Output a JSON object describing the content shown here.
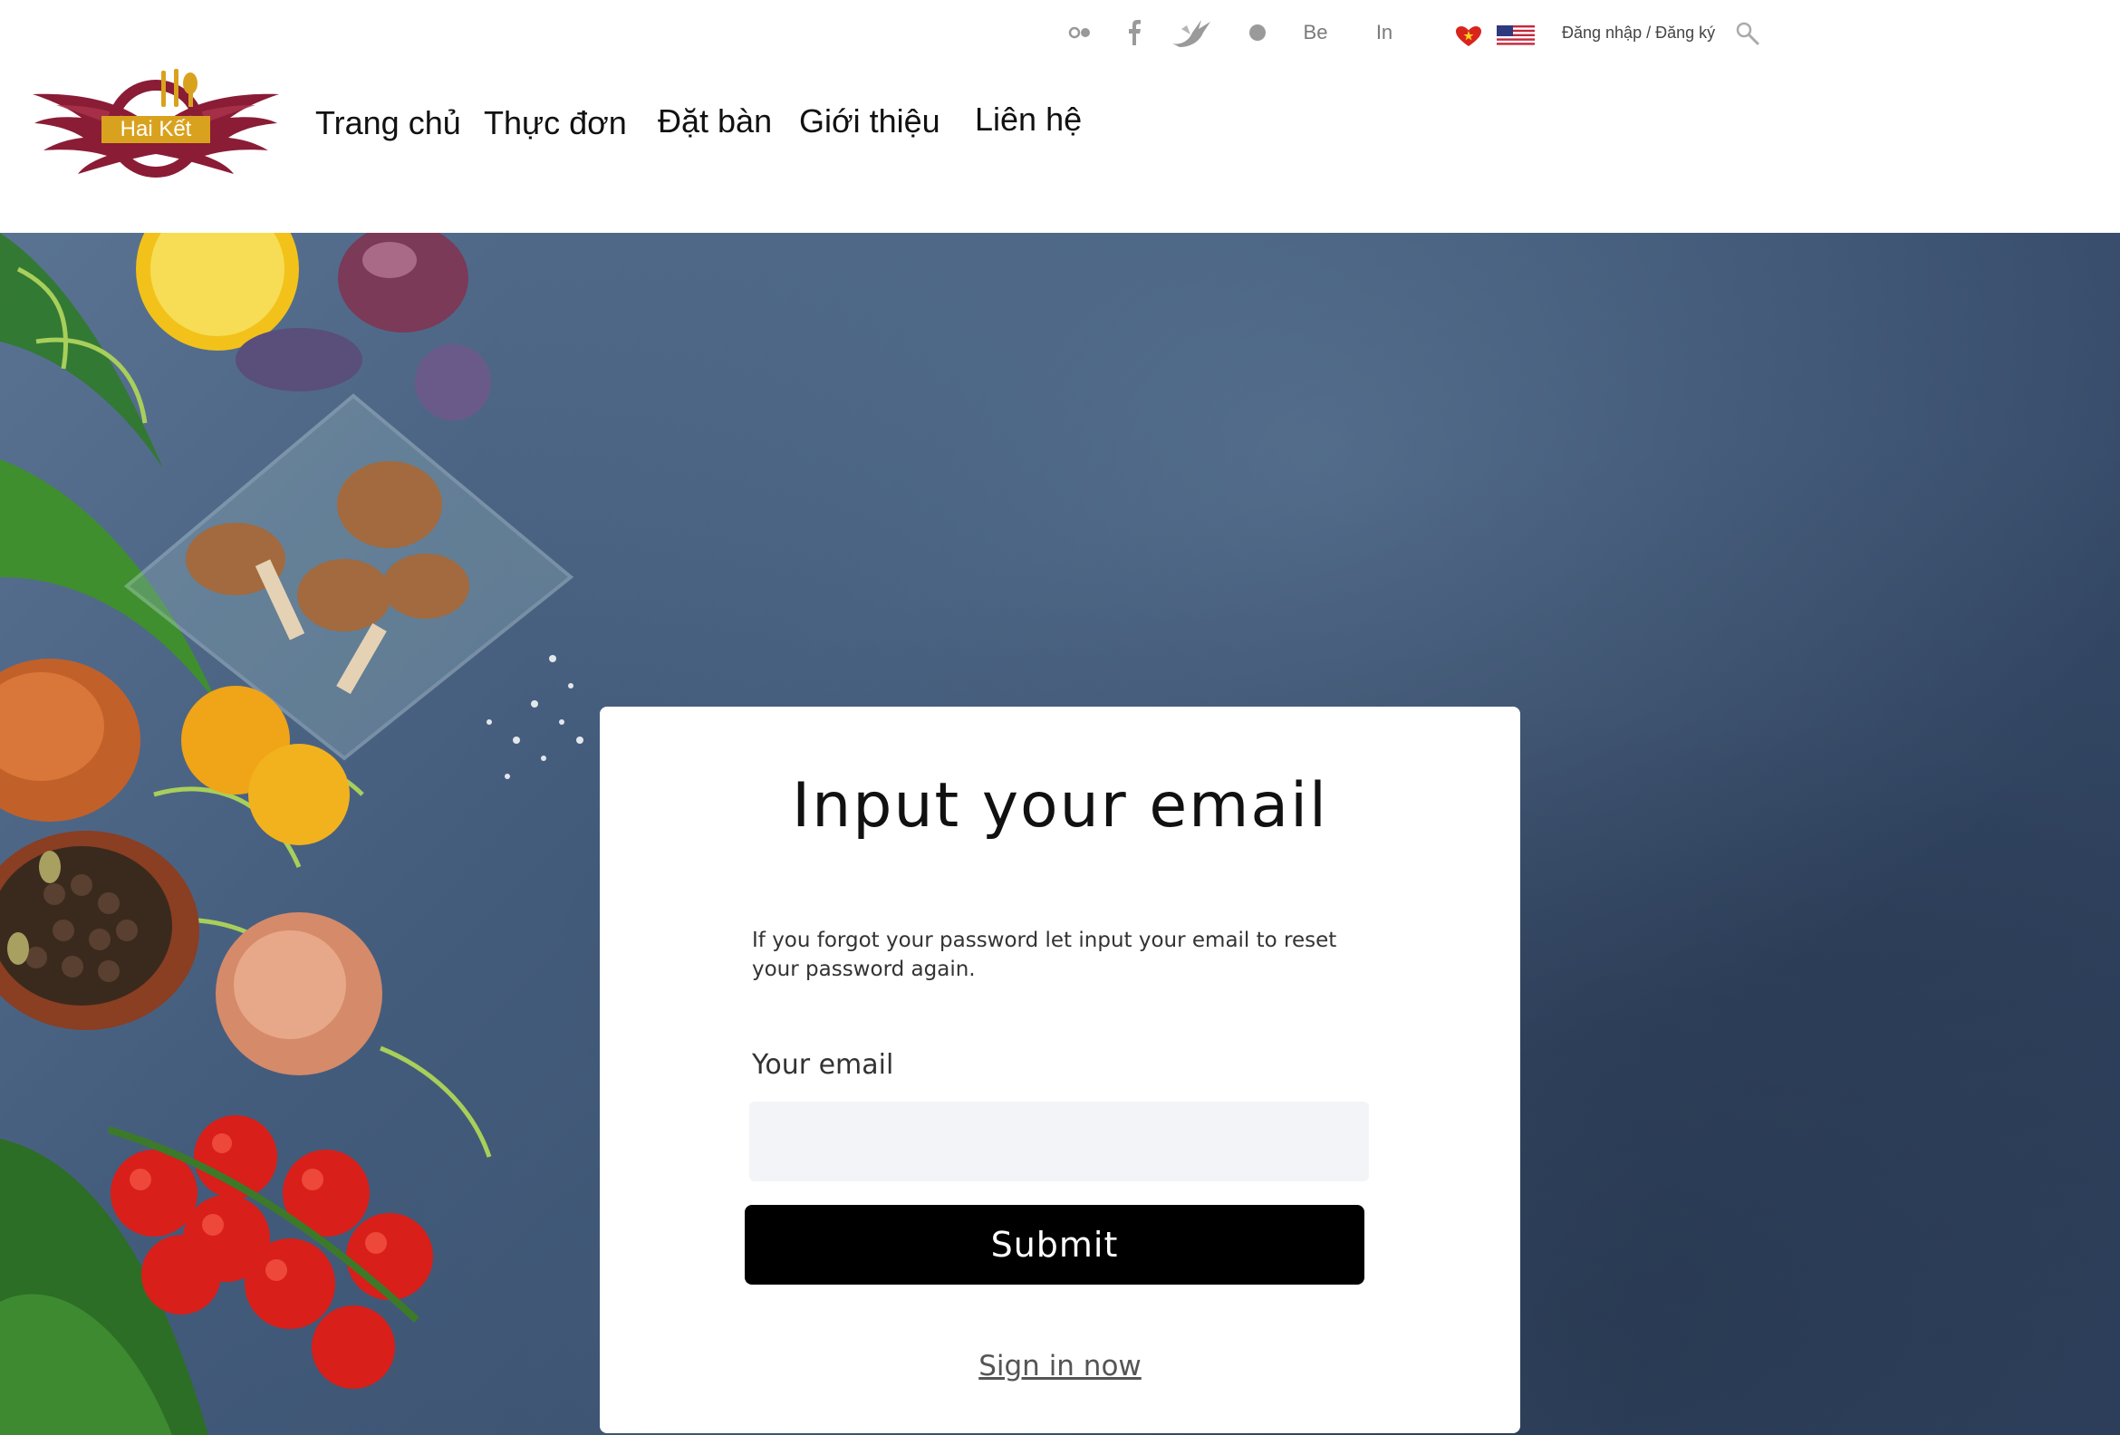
{
  "header": {
    "logo": {
      "text": "Hai Kết"
    },
    "social": {
      "behance": "Be",
      "linkedin": "In"
    },
    "auth_link": "Đăng nhập / Đăng ký",
    "nav": [
      "Trang chủ",
      "Thực đơn",
      "Đặt bàn",
      "Giới thiệu",
      "Liên hệ"
    ]
  },
  "reset_form": {
    "title": "Input your email",
    "description": "If you forgot your password let input your email to reset your password again.",
    "email_label": "Your email",
    "email_value": "",
    "submit_label": "Submit",
    "signin_label": "Sign in now"
  },
  "colors": {
    "logo_wing": "#8a1c36",
    "logo_gold": "#d9a21e",
    "button_bg": "#000000",
    "input_bg": "#f3f4f7"
  }
}
